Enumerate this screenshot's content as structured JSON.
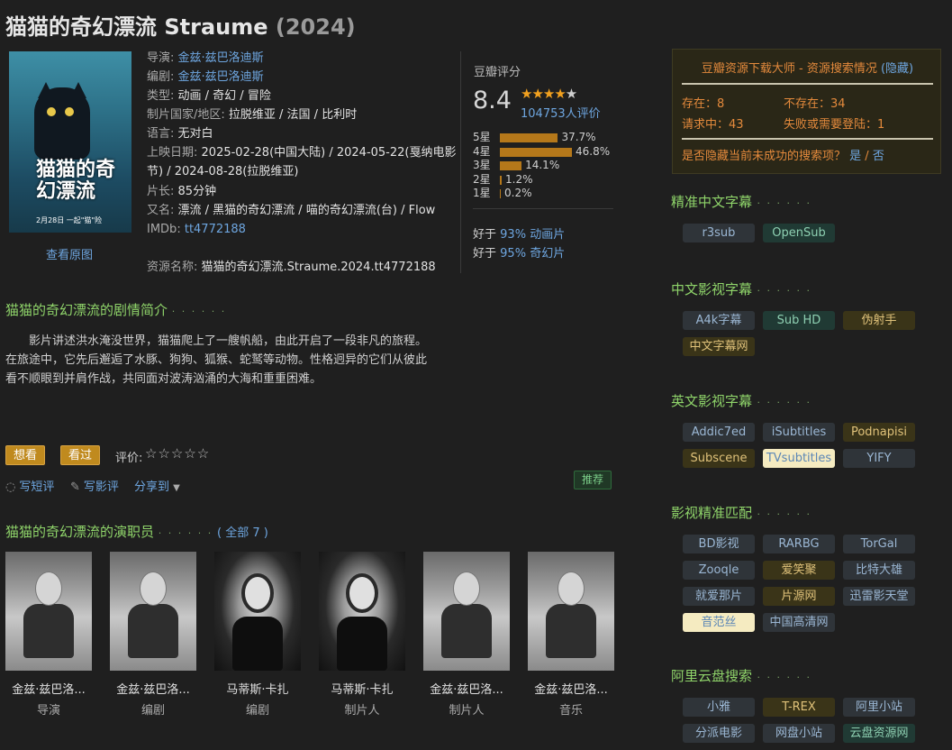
{
  "title": {
    "main": "猫猫的奇幻漂流 Straume",
    "year": "(2024)"
  },
  "poster": {
    "title_text": "猫猫的奇幻漂流",
    "date_text": "2月28日 一起\"猫\"险",
    "view_original": "查看原图"
  },
  "info": {
    "director_label": "导演:",
    "director": "金兹·兹巴洛迪斯",
    "writer_label": "编剧:",
    "writer": "金兹·兹巴洛迪斯",
    "genre_label": "类型:",
    "genre": "动画 / 奇幻 / 冒险",
    "country_label": "制片国家/地区:",
    "country": "拉脱维亚 / 法国 / 比利时",
    "language_label": "语言:",
    "language": "无对白",
    "release_label": "上映日期:",
    "release_1": "2025-02-28(中国大陆) / 2024-05-22(戛纳电影",
    "release_2": "节) / 2024-08-28(拉脱维亚)",
    "runtime_label": "片长:",
    "runtime": "85分钟",
    "aka_label": "又名:",
    "aka": "漂流 / 黑猫的奇幻漂流 / 喵的奇幻漂流(台) / Flow",
    "imdb_label": "IMDb:",
    "imdb": "tt4772188",
    "resource_label": "资源名称:",
    "resource": "猫猫的奇幻漂流.Straume.2024.tt4772188"
  },
  "rating": {
    "label": "豆瓣评分",
    "score": "8.4",
    "stars": "★★★★",
    "half": "★",
    "votes": "104753人评价",
    "rows": [
      {
        "label": "5星",
        "pct": "37.7%",
        "value": 37.7
      },
      {
        "label": "4星",
        "pct": "46.8%",
        "value": 46.8
      },
      {
        "label": "3星",
        "pct": "14.1%",
        "value": 14.1
      },
      {
        "label": "2星",
        "pct": "1.2%",
        "value": 1.2
      },
      {
        "label": "1星",
        "pct": "0.2%",
        "value": 0.2
      }
    ],
    "better_1_pre": "好于",
    "better_1_pct": "93%",
    "better_1_cat": "动画片",
    "better_2_pre": "好于",
    "better_2_pct": "95%",
    "better_2_cat": "奇幻片"
  },
  "summary": {
    "title": "猫猫的奇幻漂流的剧情简介",
    "dots": "· · · · · ·",
    "text": "影片讲述洪水淹没世界，猫猫爬上了一艘帆船，由此开启了一段非凡的旅程。在旅途中，它先后邂逅了水豚、狗狗、狐猴、蛇鹫等动物。性格迥异的它们从彼此看不顺眼到并肩作战，共同面对波涛汹涌的大海和重重困难。"
  },
  "actions": {
    "want": "想看",
    "watched": "看过",
    "rate_label": "评价:",
    "rate_stars": "☆☆☆☆☆",
    "short_review": "写短评",
    "review": "写影评",
    "share": "分享到",
    "recommend": "推荐"
  },
  "cast": {
    "title": "猫猫的奇幻漂流的演职员",
    "dots": "· · · · · ·",
    "all": "( 全部 7 )",
    "members": [
      {
        "name": "金兹·兹巴洛...",
        "role": "导演"
      },
      {
        "name": "金兹·兹巴洛...",
        "role": "编剧"
      },
      {
        "name": "马蒂斯·卡扎",
        "role": "编剧"
      },
      {
        "name": "马蒂斯·卡扎",
        "role": "制片人"
      },
      {
        "name": "金兹·兹巴洛...",
        "role": "制片人"
      },
      {
        "name": "金兹·兹巴洛...",
        "role": "音乐"
      }
    ]
  },
  "resource_box": {
    "title": "豆瓣资源下载大师 - 资源搜索情况",
    "hide": "(隐藏)",
    "exist": "存在：8",
    "not_exist": "不存在：34",
    "requesting": "请求中：43",
    "failed": "失败或需要登陆：1",
    "question": "是否隐藏当前未成功的搜索项？",
    "yes": "是",
    "sep": " / ",
    "no": "否"
  },
  "sidebar": {
    "dots": "· · · · · ·",
    "sections": [
      {
        "title": "精准中文字幕",
        "tags": [
          "r3sub",
          "OpenSub"
        ]
      },
      {
        "title": "中文影视字幕",
        "tags": [
          "A4k字幕",
          "Sub HD",
          "伪射手",
          "中文字幕网"
        ]
      },
      {
        "title": "英文影视字幕",
        "tags": [
          "Addic7ed",
          "iSubtitles",
          "Podnapisi",
          "Subscene",
          "TVsubtitles",
          "YIFY"
        ]
      },
      {
        "title": "影视精准匹配",
        "tags": [
          "BD影视",
          "RARBG",
          "TorGal",
          "Zooqle",
          "爱笑聚",
          "比特大雄",
          "就爱那片",
          "片源网",
          "迅雷影天堂",
          "音范丝",
          "中国高清网"
        ]
      },
      {
        "title": "阿里云盘搜索",
        "tags": [
          "小雅",
          "T-REX",
          "阿里小站",
          "分派电影",
          "网盘小站",
          "云盘资源网"
        ]
      }
    ]
  },
  "colors": {
    "accent_green": "#8fd46a",
    "link_blue": "#6ea6e0",
    "star_orange": "#f2a11f",
    "status_orange": "#e48a3c"
  }
}
